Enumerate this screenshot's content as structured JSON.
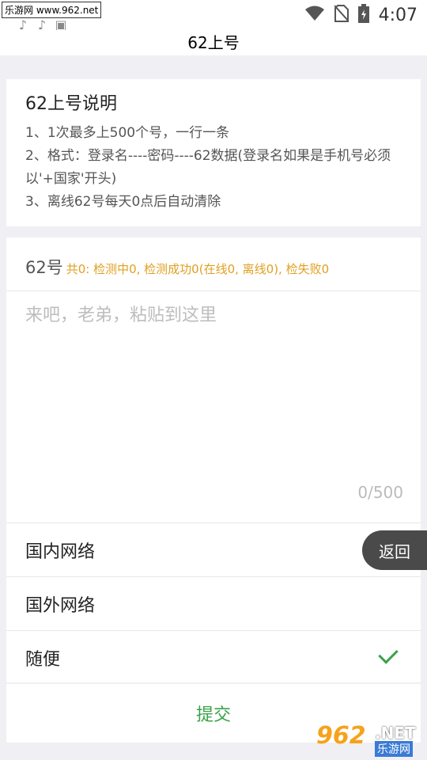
{
  "status_bar": {
    "watermark": "乐游网 www.962.net",
    "time": "4:07",
    "icons": [
      "tiktok-icon",
      "tiktok-icon",
      "image-icon",
      "wifi-icon",
      "no-sim-icon",
      "battery-icon"
    ]
  },
  "title": "62上号",
  "info": {
    "title": "62上号说明",
    "lines": [
      "1、1次最多上500个号，一行一条",
      "2、格式：登录名----密码----62数据(登录名如果是手机号必须以'+国家'开头)",
      "3、离线62号每天0点后自动清除"
    ]
  },
  "input": {
    "label": "62号",
    "stats": "共0: 检测中0, 检测成功0(在线0, 离线0), 检失败0",
    "placeholder": "来吧，老弟，粘贴到这里",
    "counter": "0/500"
  },
  "options": [
    {
      "label": "国内网络",
      "selected": false
    },
    {
      "label": "国外网络",
      "selected": false
    },
    {
      "label": "随便",
      "selected": true
    }
  ],
  "back_label": "返回",
  "submit_label": "提交",
  "watermark_bottom": {
    "num": "962",
    "net": ".NET",
    "sub": "乐游网"
  },
  "colors": {
    "accent": "#3aa24a",
    "stats": "#e0a020",
    "background": "#efeff4"
  }
}
